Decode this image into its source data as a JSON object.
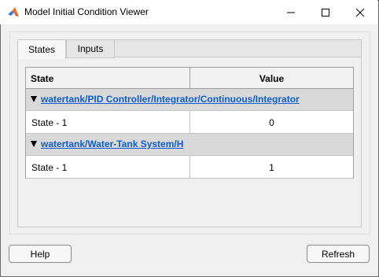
{
  "window": {
    "title": "Model Initial Condition Viewer",
    "icon": "matlab-logo-icon"
  },
  "tabs": [
    {
      "label": "States",
      "selected": true
    },
    {
      "label": "Inputs",
      "selected": false
    }
  ],
  "table": {
    "columns": [
      "State",
      "Value"
    ],
    "groups": [
      {
        "path": "watertank/PID Controller/Integrator/Continuous/Integrator",
        "expanded": true,
        "rows": [
          {
            "state": "State - 1",
            "value": "0"
          }
        ]
      },
      {
        "path": "watertank/Water-Tank System/H",
        "expanded": true,
        "rows": [
          {
            "state": "State - 1",
            "value": "1"
          }
        ]
      }
    ]
  },
  "buttons": {
    "help": "Help",
    "refresh": "Refresh"
  },
  "colors": {
    "link": "#0b5cd5",
    "group_background": "#d9d9d9"
  }
}
